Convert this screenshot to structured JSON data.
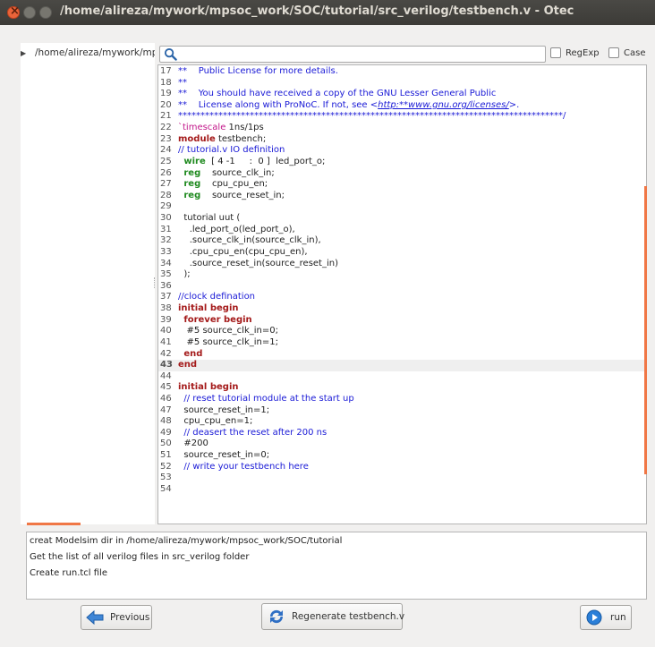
{
  "window": {
    "title": "/home/alireza/mywork/mpsoc_work/SOC/tutorial/src_verilog/testbench.v - Otec"
  },
  "sidebar": {
    "items": [
      {
        "label": "/home/alireza/mywork/mpsoc_work/SOC/tutorial"
      }
    ]
  },
  "search": {
    "value": "",
    "regexp_label": "RegExp",
    "case_label": "Case",
    "regexp_checked": false,
    "case_checked": false
  },
  "editor": {
    "current_line": 43,
    "lines": [
      {
        "n": "17",
        "tokens": [
          {
            "t": "**    Public License for more details.",
            "c": "comment"
          }
        ]
      },
      {
        "n": "18",
        "tokens": [
          {
            "t": "**",
            "c": "comment"
          }
        ]
      },
      {
        "n": "19",
        "tokens": [
          {
            "t": "**    You should have received a copy of the GNU Lesser General Public",
            "c": "comment"
          }
        ]
      },
      {
        "n": "20",
        "tokens": [
          {
            "t": "**    License along with ProNoC. If not, see <",
            "c": "comment"
          },
          {
            "t": "http:**www.gnu.org/licenses/",
            "c": "link"
          },
          {
            "t": ">.",
            "c": "comment"
          }
        ]
      },
      {
        "n": "21",
        "tokens": [
          {
            "t": "**************************************************************************************/",
            "c": "comment"
          }
        ]
      },
      {
        "n": "22",
        "tokens": [
          {
            "t": "`timescale",
            "c": "directive"
          },
          {
            "t": " 1ns/1ps",
            "c": "plain"
          }
        ]
      },
      {
        "n": "23",
        "tokens": [
          {
            "t": "module",
            "c": "keyword"
          },
          {
            "t": " testbench;",
            "c": "plain"
          }
        ]
      },
      {
        "n": "24",
        "tokens": [
          {
            "t": "// tutorial.v IO definition",
            "c": "comment"
          }
        ]
      },
      {
        "n": "25",
        "tokens": [
          {
            "t": "  ",
            "c": "plain"
          },
          {
            "t": "wire",
            "c": "type"
          },
          {
            "t": "  [ 4 -1     :  0 ]  led_port_o;",
            "c": "plain"
          }
        ]
      },
      {
        "n": "26",
        "tokens": [
          {
            "t": "  ",
            "c": "plain"
          },
          {
            "t": "reg",
            "c": "type"
          },
          {
            "t": "    source_clk_in;",
            "c": "plain"
          }
        ]
      },
      {
        "n": "27",
        "tokens": [
          {
            "t": "  ",
            "c": "plain"
          },
          {
            "t": "reg",
            "c": "type"
          },
          {
            "t": "    cpu_cpu_en;",
            "c": "plain"
          }
        ]
      },
      {
        "n": "28",
        "tokens": [
          {
            "t": "  ",
            "c": "plain"
          },
          {
            "t": "reg",
            "c": "type"
          },
          {
            "t": "    source_reset_in;",
            "c": "plain"
          }
        ]
      },
      {
        "n": "29",
        "tokens": []
      },
      {
        "n": "30",
        "tokens": [
          {
            "t": "  tutorial uut (",
            "c": "plain"
          }
        ]
      },
      {
        "n": "31",
        "tokens": [
          {
            "t": "    .led_port_o(led_port_o),",
            "c": "plain"
          }
        ]
      },
      {
        "n": "32",
        "tokens": [
          {
            "t": "    .source_clk_in(source_clk_in),",
            "c": "plain"
          }
        ]
      },
      {
        "n": "33",
        "tokens": [
          {
            "t": "    .cpu_cpu_en(cpu_cpu_en),",
            "c": "plain"
          }
        ]
      },
      {
        "n": "34",
        "tokens": [
          {
            "t": "    .source_reset_in(source_reset_in)",
            "c": "plain"
          }
        ]
      },
      {
        "n": "35",
        "tokens": [
          {
            "t": "  );",
            "c": "plain"
          }
        ]
      },
      {
        "n": "36",
        "tokens": []
      },
      {
        "n": "37",
        "tokens": [
          {
            "t": "//clock defination",
            "c": "comment"
          }
        ]
      },
      {
        "n": "38",
        "tokens": [
          {
            "t": "initial begin",
            "c": "keyword"
          }
        ]
      },
      {
        "n": "39",
        "tokens": [
          {
            "t": "  ",
            "c": "plain"
          },
          {
            "t": "forever begin",
            "c": "keyword"
          }
        ]
      },
      {
        "n": "40",
        "tokens": [
          {
            "t": "   #5 source_clk_in=0;",
            "c": "plain"
          }
        ]
      },
      {
        "n": "41",
        "tokens": [
          {
            "t": "   #5 source_clk_in=1;",
            "c": "plain"
          }
        ]
      },
      {
        "n": "42",
        "tokens": [
          {
            "t": "  ",
            "c": "plain"
          },
          {
            "t": "end",
            "c": "keyword"
          }
        ]
      },
      {
        "n": "43",
        "tokens": [
          {
            "t": "end",
            "c": "keyword"
          }
        ]
      },
      {
        "n": "44",
        "tokens": []
      },
      {
        "n": "45",
        "tokens": [
          {
            "t": "initial begin",
            "c": "keyword"
          }
        ]
      },
      {
        "n": "46",
        "tokens": [
          {
            "t": "  // reset tutorial module at the start up",
            "c": "comment"
          }
        ]
      },
      {
        "n": "47",
        "tokens": [
          {
            "t": "  source_reset_in=1;",
            "c": "plain"
          }
        ]
      },
      {
        "n": "48",
        "tokens": [
          {
            "t": "  cpu_cpu_en=1;",
            "c": "plain"
          }
        ]
      },
      {
        "n": "49",
        "tokens": [
          {
            "t": "  // deasert the reset after 200 ns",
            "c": "comment"
          }
        ]
      },
      {
        "n": "50",
        "tokens": [
          {
            "t": "  #200",
            "c": "plain"
          }
        ]
      },
      {
        "n": "51",
        "tokens": [
          {
            "t": "  source_reset_in=0;",
            "c": "plain"
          }
        ]
      },
      {
        "n": "52",
        "tokens": [
          {
            "t": "  // write your testbench here",
            "c": "comment"
          }
        ]
      },
      {
        "n": "53",
        "tokens": []
      },
      {
        "n": "54",
        "tokens": []
      }
    ]
  },
  "log": {
    "lines": [
      "creat Modelsim dir in /home/alireza/mywork/mpsoc_work/SOC/tutorial",
      "Get the list of all verilog files in src_verilog folder",
      "Create run.tcl file"
    ]
  },
  "buttons": {
    "previous_label": "Previous",
    "regenerate_label": "Regenerate testbench.v",
    "run_label": "run"
  },
  "colors": {
    "comment": "#1a1ad6",
    "keyword": "#a41a1a",
    "type": "#1f8a1f",
    "directive": "#c2168a",
    "plain": "#222222",
    "link": "#1a1ad6",
    "accent": "#f07746"
  }
}
